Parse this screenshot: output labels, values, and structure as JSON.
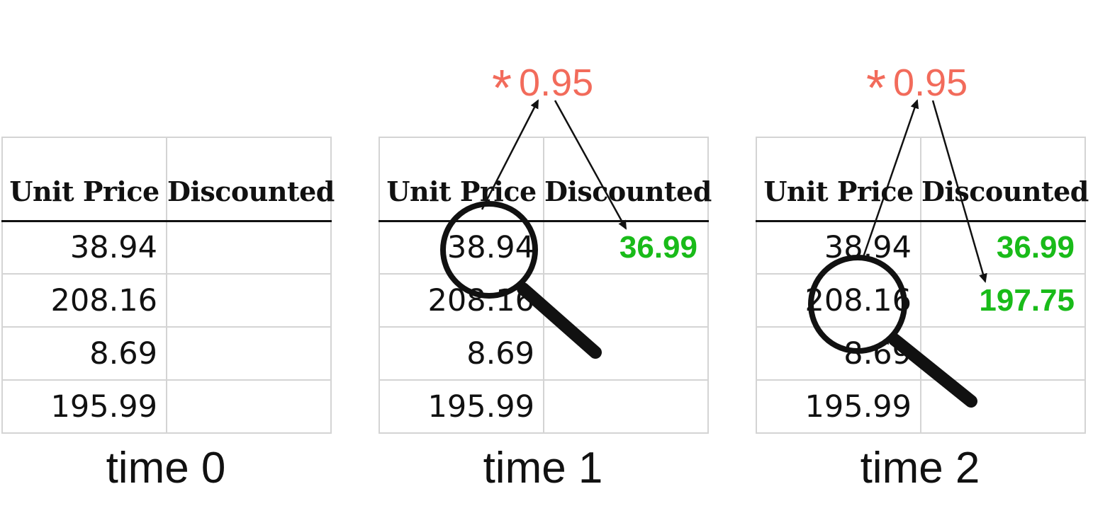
{
  "columns": [
    "Unit Price",
    "Discounted"
  ],
  "unit_prices": [
    "38.94",
    "208.16",
    "8.69",
    "195.99"
  ],
  "multiplier": {
    "symbol": "*",
    "value": "0.95",
    "color": "#f26b5b"
  },
  "result_color": "#19bb19",
  "panels": [
    {
      "caption": "time 0",
      "discounted": [
        "",
        "",
        "",
        ""
      ]
    },
    {
      "caption": "time 1",
      "discounted": [
        "36.99",
        "",
        "",
        ""
      ]
    },
    {
      "caption": "time 2",
      "discounted": [
        "36.99",
        "197.75",
        "",
        ""
      ]
    }
  ],
  "icons": [
    "magnifier-icon",
    "arrow-icon"
  ]
}
